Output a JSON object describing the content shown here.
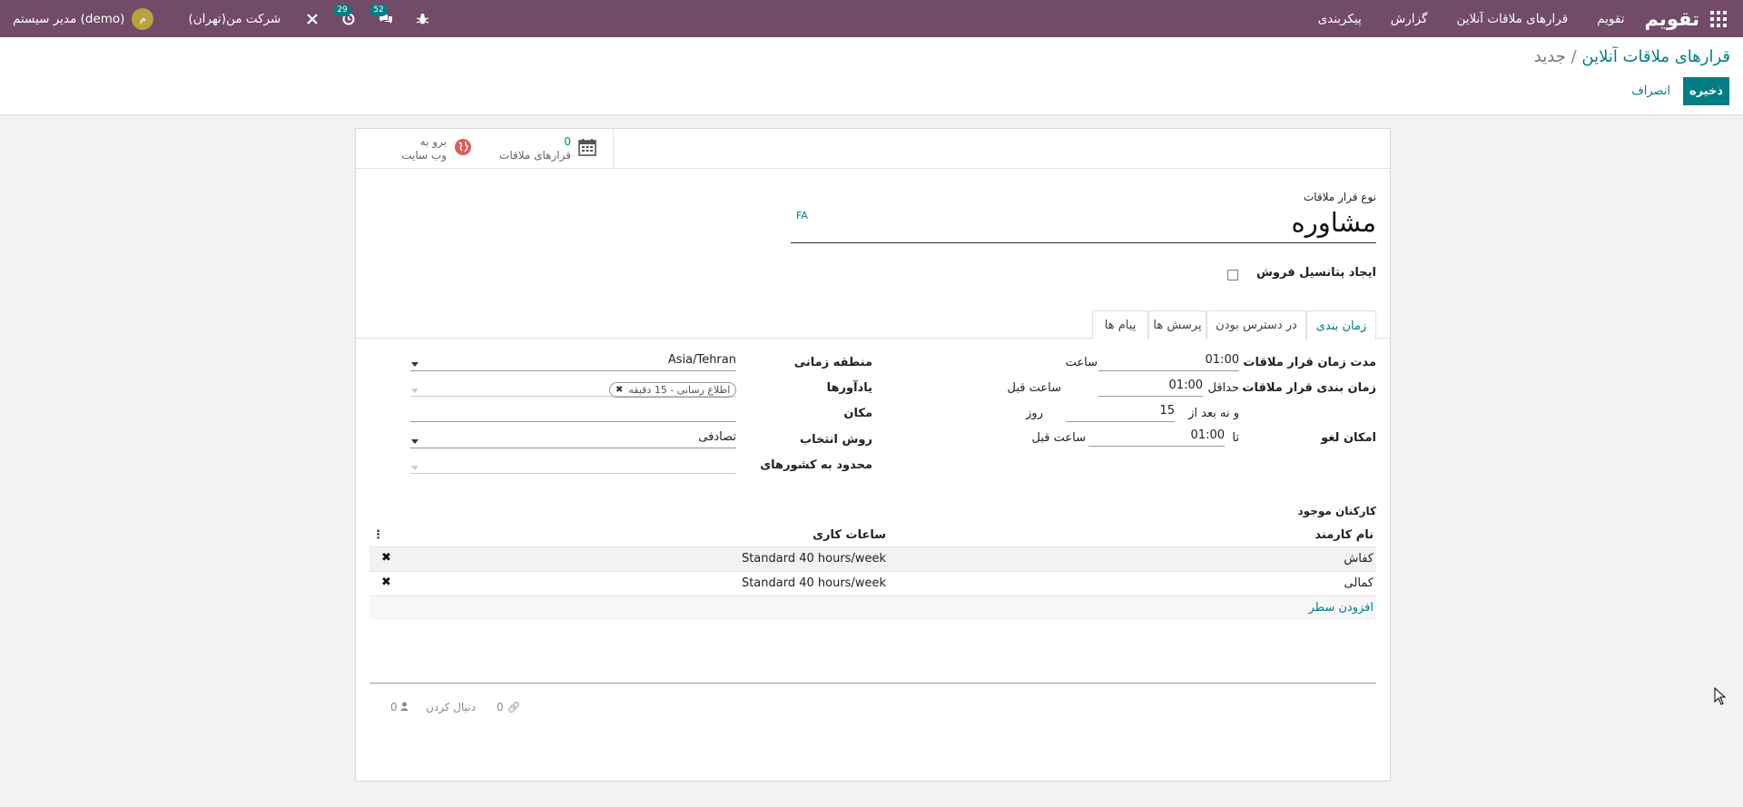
{
  "topbar": {
    "brand": "تقویم",
    "menu": [
      "تقویم",
      "قرارهای ملاقات آنلاین",
      "گزارش",
      "پیکربندی"
    ],
    "company": "شرکت من(تهران)",
    "user_name": "مدیر سیستم (demo)",
    "user_initial": "م",
    "chat_count": "52",
    "activity_count": "29",
    "icons": [
      "apps-grid-icon",
      "bug-icon",
      "chat-icon",
      "activity-clock-icon",
      "tools-icon"
    ]
  },
  "control_panel": {
    "breadcrumb_parent": "قرارهای ملاقات آنلاین",
    "breadcrumb_sep": "/",
    "breadcrumb_current": "جدید",
    "save_label": "ذخیره",
    "discard_label": "انصراف"
  },
  "smart_buttons": {
    "meetings_count": "0",
    "meetings_label": "قرارهای ملاقات",
    "website_line1": "برو به",
    "website_line2": "وب سایت"
  },
  "form": {
    "type_label": "نوع قرار ملاقات",
    "name": "مشاوره",
    "lang": "FA",
    "opportunity_label": "ایجاد پتانسیل فروش",
    "opportunity_checked": false,
    "tabs": [
      "زمان بندی",
      "در دسترس بودن",
      "پرسش ها",
      "پیام ها"
    ],
    "active_tab": "زمان بندی",
    "duration_label": "مدت زمان قرار ملاقات",
    "duration_value": "01:00",
    "duration_unit": "ساعت",
    "scheduling_label": "زمان بندی قرار ملاقات",
    "scheduling_min_prefix": "حداقل",
    "scheduling_min_value": "01:00",
    "scheduling_min_suffix": "ساعت قبل",
    "scheduling_max_prefix": "و نه بعد از",
    "scheduling_max_value": "15",
    "scheduling_max_suffix": "روز",
    "cancel_label": "امکان لغو",
    "cancel_prefix": "تا",
    "cancel_value": "01:00",
    "cancel_suffix": "ساعت قبل",
    "timezone_label": "منطقه زمانی",
    "timezone_value": "Asia/Tehran",
    "reminders_label": "یادآورها",
    "reminder_tag": "اطلاع رسانی - 15 دقیقه",
    "location_label": "مکان",
    "location_value": "",
    "assign_method_label": "روش انتخاب",
    "assign_method_value": "تصادفی",
    "countries_label": "محدود به کشورهای",
    "countries_value": ""
  },
  "employees": {
    "section_label": "کارکنان موجود",
    "col_name": "نام کارمند",
    "col_hours": "ساعات کاری",
    "rows": [
      {
        "name": "کفاش",
        "hours": "Standard 40 hours/week"
      },
      {
        "name": "کمالی",
        "hours": "Standard 40 hours/week"
      }
    ],
    "add_line": "افزودن سطر"
  },
  "chatter": {
    "attachments": "0",
    "follow_label": "دنبال کردن",
    "followers": "0"
  },
  "colors": {
    "topbar": "#714b67",
    "accent": "#017e84",
    "avatar": "#b8a33e",
    "website_icon": "#e05a5a"
  }
}
